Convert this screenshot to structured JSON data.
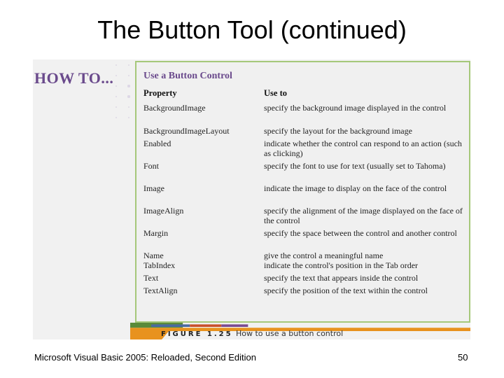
{
  "slide": {
    "title": "The Button Tool (continued)",
    "footer": "Microsoft Visual Basic 2005: Reloaded, Second Edition",
    "page_number": "50"
  },
  "figure": {
    "howto_label": "HOW TO...",
    "panel_title": "Use a Button Control",
    "headers": {
      "property": "Property",
      "use": "Use to"
    },
    "rows": [
      {
        "property": "BackgroundImage",
        "use": "specify the background image displayed in the control"
      },
      {
        "property": "BackgroundImageLayout",
        "use": "specify the layout for the background image"
      },
      {
        "property": "Enabled",
        "use": "indicate whether the control can respond to an action (such as clicking)"
      },
      {
        "property": "Font",
        "use": "specify the font to use for text (usually set to Tahoma)"
      },
      {
        "property": "Image",
        "use": "indicate the image to display on the face of the control"
      },
      {
        "property": "ImageAlign",
        "use": "specify the alignment of the image displayed on the face of the control"
      },
      {
        "property": "Margin",
        "use": "specify the space between the control and another control"
      },
      {
        "property": "Name",
        "use": "give the control a meaningful name"
      },
      {
        "property": "TabIndex",
        "use": "indicate the control's position in the Tab order"
      },
      {
        "property": "Text",
        "use": "specify the text that appears inside the control"
      },
      {
        "property": "TextAlign",
        "use": "specify the position of the text within the control"
      }
    ],
    "figure_label": "FIGURE 1.25",
    "caption": "How to use a button control",
    "colors": {
      "accent_purple": "#6a4a8c",
      "panel_border": "#a5c87a",
      "orange": "#e8921e",
      "blue": "#4a6aa0",
      "red": "#c8502a",
      "purple": "#7a4a90"
    }
  }
}
